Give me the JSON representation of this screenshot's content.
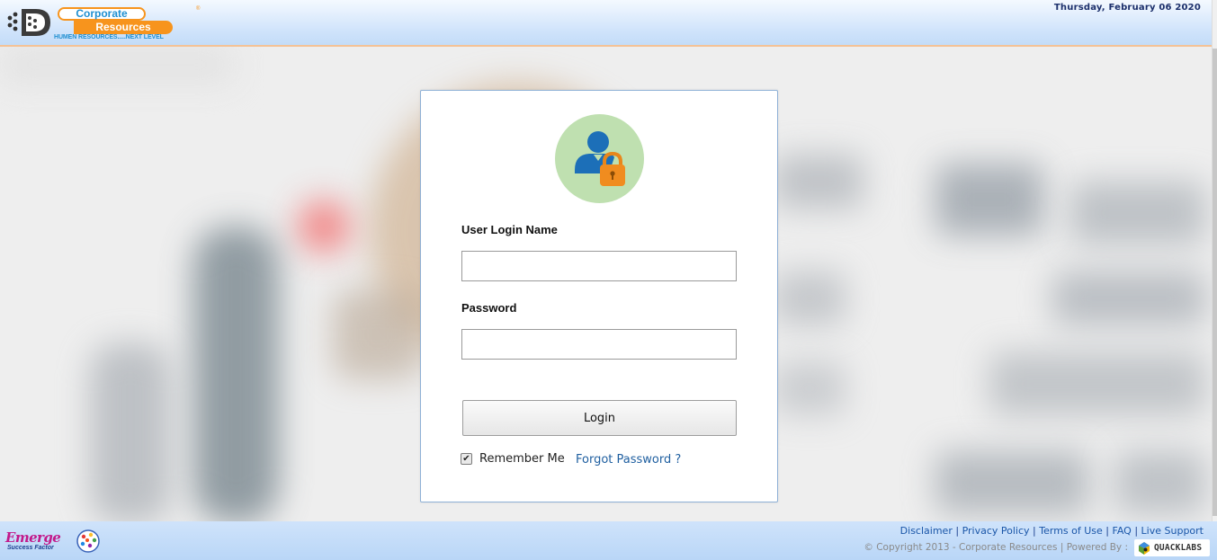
{
  "header": {
    "brand_top": "Corporate",
    "brand_bottom": "Resources",
    "tagline": "HUMEN RESOURCES.....NEXT LEVEL",
    "date": "Thursday, February 06 2020"
  },
  "login": {
    "username_label": "User Login Name",
    "username_value": "",
    "password_label": "Password",
    "password_value": "",
    "login_button": "Login",
    "remember_me_label": "Remember Me",
    "remember_me_checked": true,
    "forgot_password_link": "Forgot Password ?"
  },
  "footer": {
    "emerge_name": "Emerge",
    "emerge_tagline": "Success Factor",
    "links": [
      {
        "label": "Disclaimer"
      },
      {
        "label": "Privacy Policy"
      },
      {
        "label": "Terms of Use"
      },
      {
        "label": "FAQ"
      },
      {
        "label": "Live Support"
      }
    ],
    "link_separator": "|",
    "copyright": "© Copyright 2013 - Corporate Resources",
    "powered_by": "Powered By :",
    "powered_by_brand": "QUACKLABS"
  },
  "colors": {
    "brand_orange": "#f7941d",
    "brand_blue": "#1f8fd1",
    "avatar_bg": "#bfe0b0",
    "link_blue": "#1a56a8"
  },
  "icons": {
    "avatar": "user-lock-icon",
    "checkbox": "checkmark-icon"
  }
}
